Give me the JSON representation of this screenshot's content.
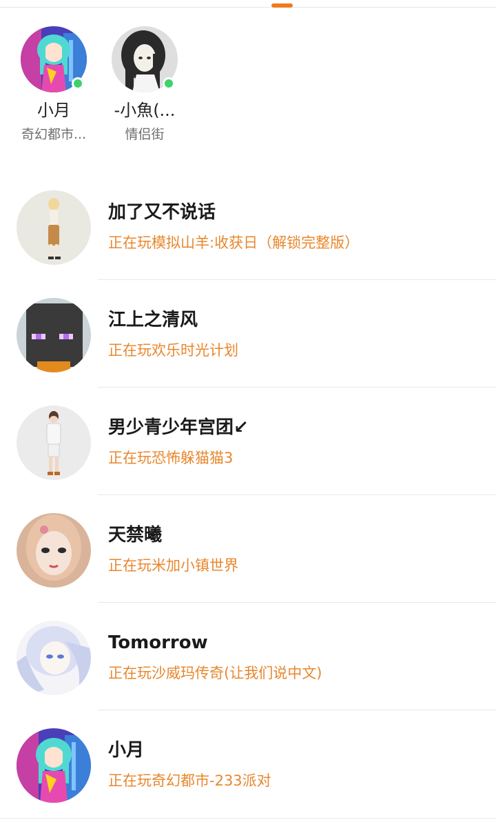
{
  "online_users": [
    {
      "name": "小月",
      "location": "奇幻都市...",
      "online": true,
      "avatar": "anime-girl-teal-hair-avatar"
    },
    {
      "name": "-小魚(...",
      "location": "情侣街",
      "online": true,
      "avatar": "dark-hair-girl-avatar"
    }
  ],
  "friends": [
    {
      "name": "加了又不说话",
      "status": "正在玩模拟山羊:收获日（解锁完整版）",
      "avatar": "standing-blonde-figure-avatar"
    },
    {
      "name": "江上之清风",
      "status": "正在玩欢乐时光计划",
      "avatar": "blocky-enderman-avatar"
    },
    {
      "name": "男少青少年宫团↙",
      "status": "正在玩恐怖躲猫猫3",
      "avatar": "standing-boy-figure-avatar"
    },
    {
      "name": "天禁曦",
      "status": "正在玩米加小镇世界",
      "avatar": "sketch-girl-face-avatar"
    },
    {
      "name": "Tomorrow",
      "status": "正在玩沙威玛传奇(让我们说中文)",
      "avatar": "white-hair-anime-avatar"
    },
    {
      "name": "小月",
      "status": "正在玩奇幻都市-233派对",
      "avatar": "anime-girl-teal-hair-avatar"
    }
  ],
  "colors": {
    "accent": "#f07a1c",
    "status_text": "#e8872c",
    "online_dot": "#3fd26a"
  }
}
